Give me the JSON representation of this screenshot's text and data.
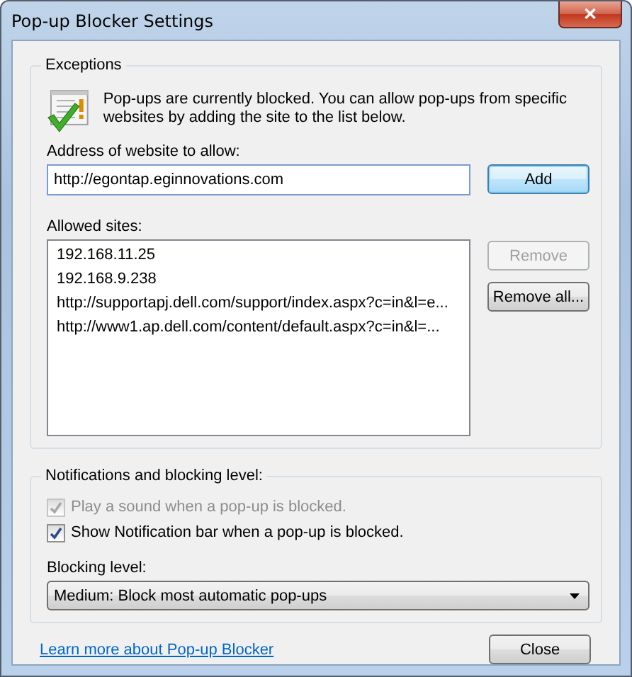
{
  "window": {
    "title": "Pop-up Blocker Settings",
    "close_glyph": "✕"
  },
  "exceptions": {
    "title": "Exceptions",
    "message": "Pop-ups are currently blocked.  You can allow pop-ups from specific websites by adding the site to the list below.",
    "address_label": "Address of website to allow:",
    "address_value": "http://egontap.eginnovations.com",
    "add_button": {
      "label": "Add",
      "disabled": false
    },
    "allowed_label": "Allowed sites:",
    "allowed_sites": [
      {
        "text": "192.168.11.25",
        "selected": false
      },
      {
        "text": "192.168.9.238",
        "selected": false
      },
      {
        "text": "http://supportapj.dell.com/support/index.aspx?c=in&l=e...",
        "selected": false
      },
      {
        "text": "http://www1.ap.dell.com/content/default.aspx?c=in&l=...",
        "selected": false
      }
    ],
    "buttons": [
      {
        "label": "Remove",
        "disabled": true
      },
      {
        "label": "Remove all...",
        "disabled": false
      }
    ]
  },
  "notifications": {
    "title": "Notifications and blocking level:",
    "options": [
      {
        "label": "Play a sound when a pop-up is blocked.",
        "checked": true,
        "disabled": true
      },
      {
        "label": "Show Notification bar when a pop-up is blocked.",
        "checked": true,
        "disabled": false
      }
    ],
    "blocking_label": "Blocking level:",
    "blocking_value": "Medium: Block most automatic pop-ups"
  },
  "footer": {
    "link": "Learn more about Pop-up Blocker",
    "close_button": {
      "label": "Close",
      "disabled": false
    }
  }
}
